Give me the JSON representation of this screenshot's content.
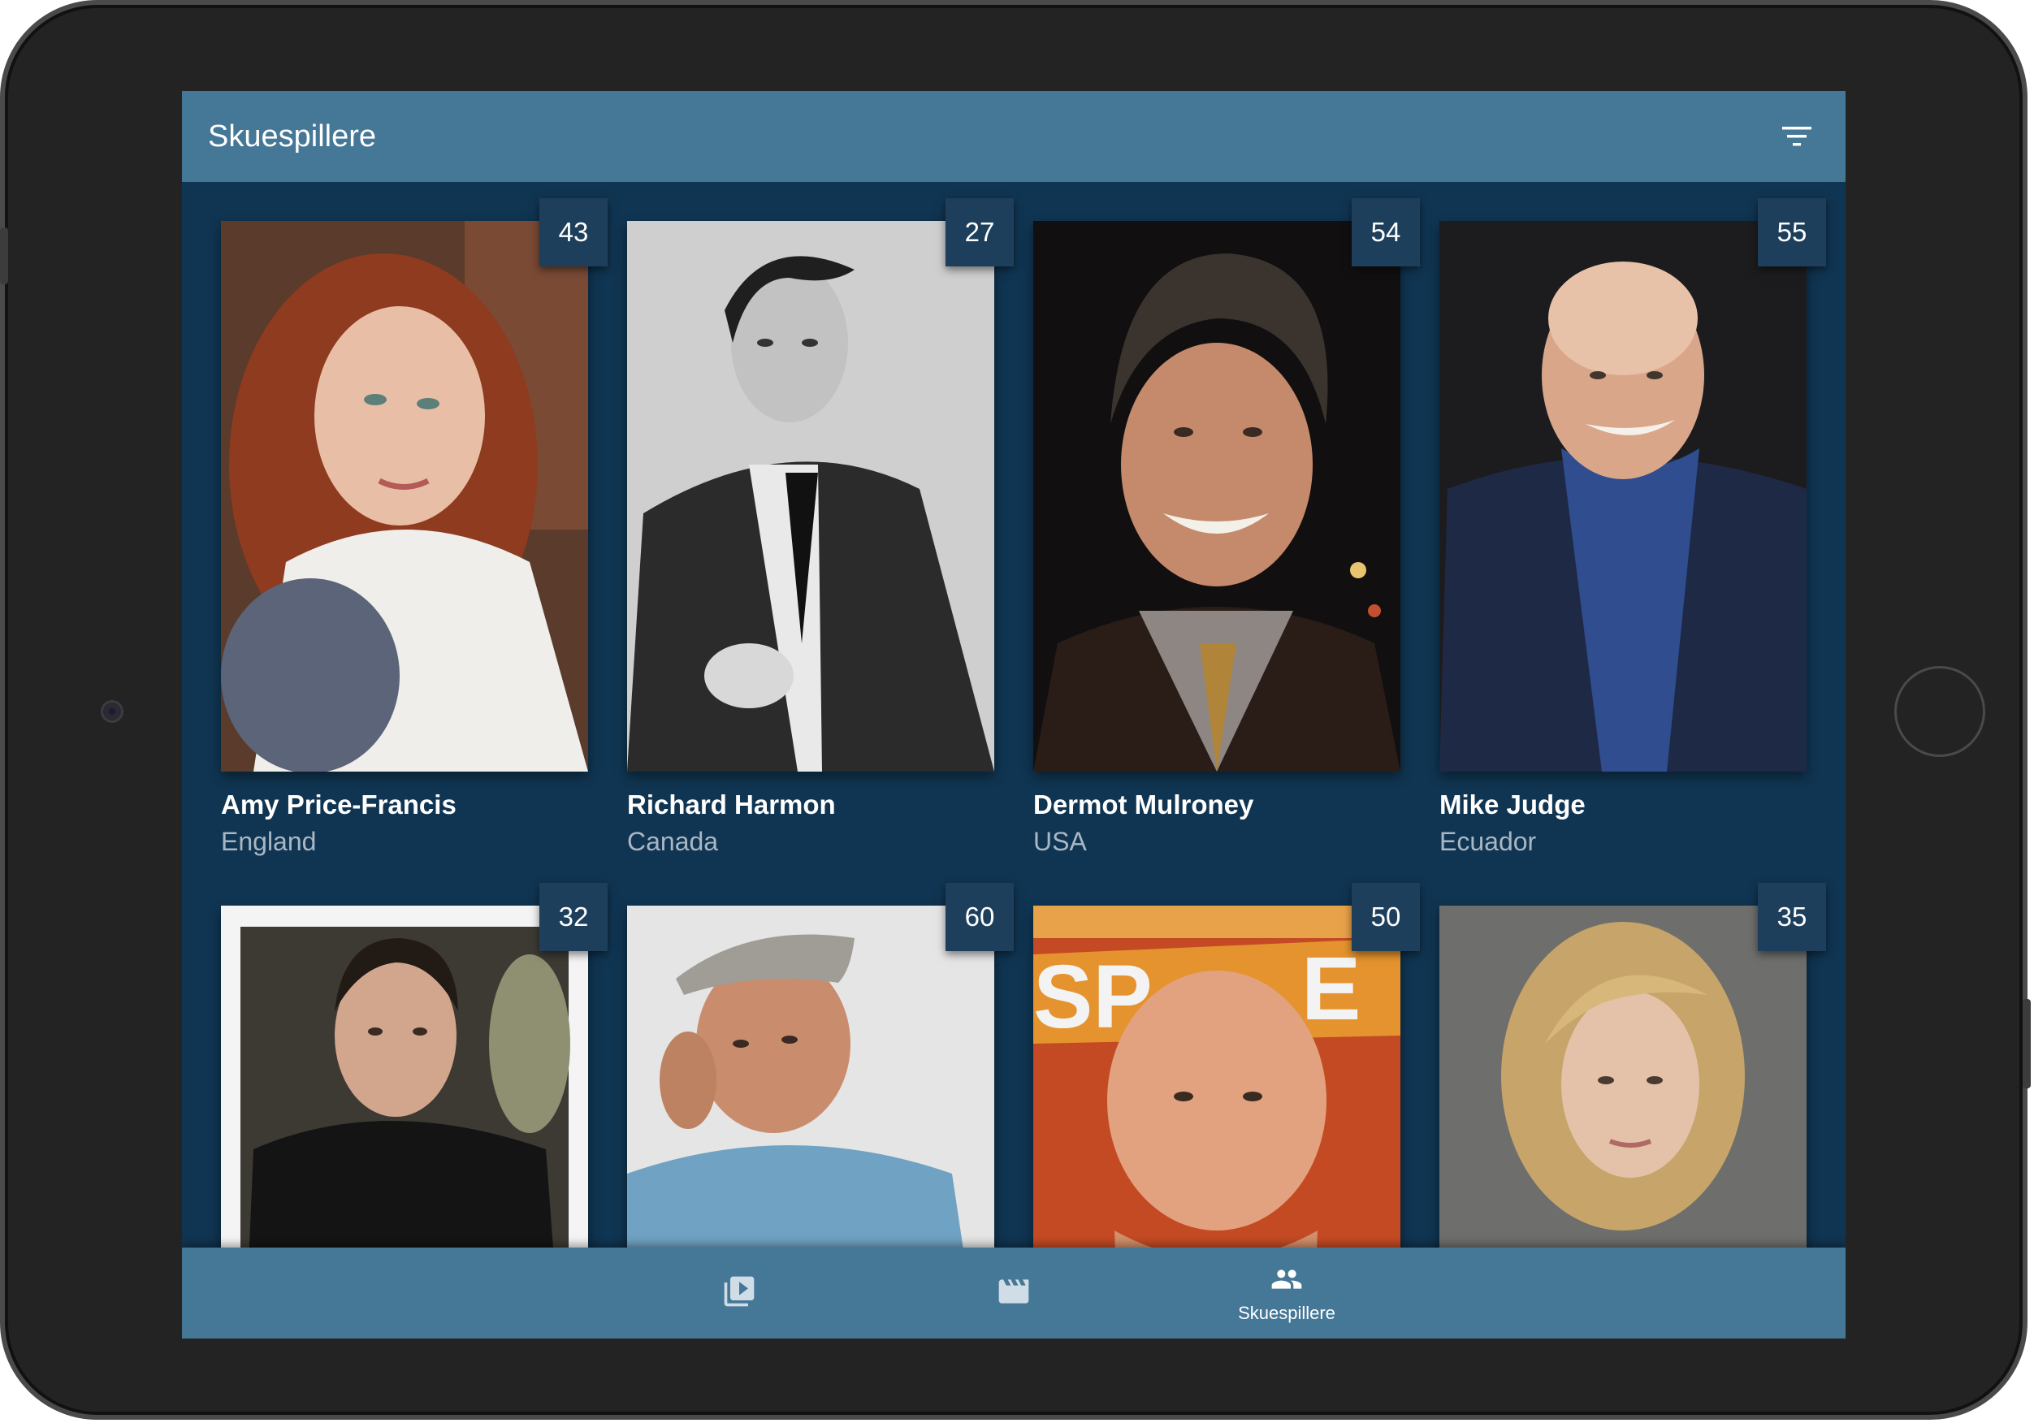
{
  "app": {
    "title": "Skuespillere"
  },
  "actors": [
    {
      "name": "Amy Price-Francis",
      "country": "England",
      "age": "43",
      "photo": "amy-price-francis-photo"
    },
    {
      "name": "Richard Harmon",
      "country": "Canada",
      "age": "27",
      "photo": "richard-harmon-photo"
    },
    {
      "name": "Dermot Mulroney",
      "country": "USA",
      "age": "54",
      "photo": "dermot-mulroney-photo"
    },
    {
      "name": "Mike Judge",
      "country": "Ecuador",
      "age": "55",
      "photo": "mike-judge-photo"
    },
    {
      "name": "",
      "country": "",
      "age": "32",
      "photo": "actor-photo"
    },
    {
      "name": "",
      "country": "",
      "age": "60",
      "photo": "actor-photo"
    },
    {
      "name": "",
      "country": "",
      "age": "50",
      "photo": "actor-photo"
    },
    {
      "name": "",
      "country": "",
      "age": "35",
      "photo": "actor-photo"
    }
  ],
  "bottom_nav": {
    "items": [
      {
        "icon": "video-library-icon",
        "label": ""
      },
      {
        "icon": "movie-clapper-icon",
        "label": ""
      },
      {
        "icon": "people-icon",
        "label": "Skuespillere"
      }
    ]
  },
  "colors": {
    "app_bar": "#457797",
    "background": "#103552",
    "badge": "#1d3f5c",
    "secondary_text": "#a9b7c4"
  }
}
